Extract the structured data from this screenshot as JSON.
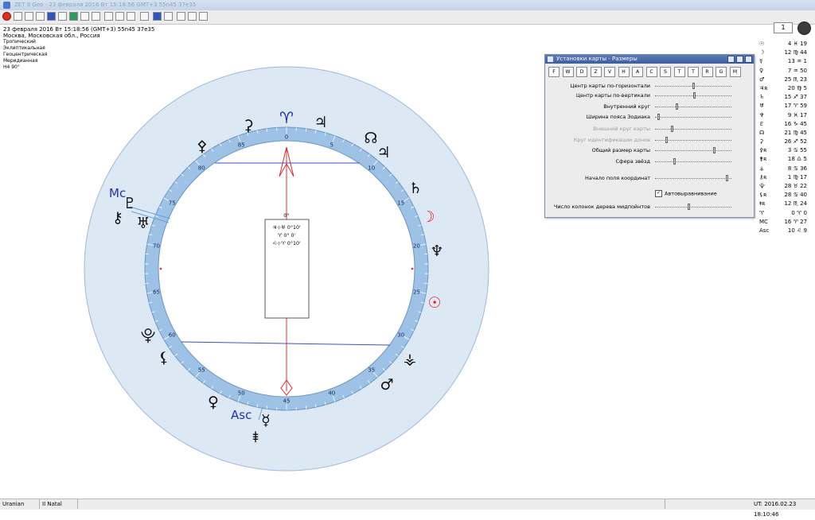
{
  "window": {
    "title": "ZET 9 Geo - 23 февраля 2016  Вт  15:18:56 GMT+3 55n45  37e35"
  },
  "toolbar": {
    "page_value": "1"
  },
  "info": {
    "line1": "23 февраля 2016  Вт  15:18:56 (GMT+3) 55n45  37e35",
    "line2": "Москва, Московская обл., Россия",
    "line3": "Тропический",
    "line4": "Эклиптикальная",
    "line5": "Геоцентрическая",
    "line6": "Меридианная",
    "line7": "H4  90°"
  },
  "chart": {
    "center_box": {
      "header": "0°",
      "row1": "♃⊹♅  0°10'",
      "row2": "♈   0° 0'",
      "row3": "♌⊹♈  0°10'"
    },
    "labels": {
      "mc": "Mc",
      "asc": "Asc"
    },
    "ring_numbers": [
      "0",
      "5",
      "10",
      "15",
      "20",
      "25",
      "30",
      "35",
      "40",
      "45",
      "50",
      "55",
      "60",
      "65",
      "70",
      "75",
      "80",
      "85"
    ],
    "aries_glyph": "♈",
    "colors": {
      "outer_fill": "#dde8f5",
      "ring_fill": "#9ec2e6",
      "inner_fill": "#ffffff",
      "axis_line": "#d83030",
      "cross_line": "#3a4fd0",
      "label_blue": "#2030b0",
      "sun_moon": "#e02020"
    }
  },
  "positions": [
    {
      "glyph": "☉",
      "value": "4 ♓ 19"
    },
    {
      "glyph": "☽",
      "value": "12 ♍ 44"
    },
    {
      "glyph": "☿",
      "value": "13 ♒  1"
    },
    {
      "glyph": "♀",
      "value": "7 ♒ 50"
    },
    {
      "glyph": "♂",
      "value": "25 ♏ 23"
    },
    {
      "glyph": "♃ʀ",
      "value": "20 ♍  5"
    },
    {
      "glyph": "♄",
      "value": "15 ♐ 37"
    },
    {
      "glyph": "♅",
      "value": "17 ♈ 59"
    },
    {
      "glyph": "♆",
      "value": "9 ♓ 17"
    },
    {
      "glyph": "♇",
      "value": "16 ♑ 45"
    },
    {
      "glyph": "☊",
      "value": "21 ♍ 45"
    },
    {
      "glyph": "⚳",
      "value": "26 ♐ 52"
    },
    {
      "glyph": "⚴ʀ",
      "value": "3 ♋ 55"
    },
    {
      "glyph": "⚵ʀ",
      "value": "18 ♎  5"
    },
    {
      "glyph": "⚶",
      "value": "8 ♋ 36"
    },
    {
      "glyph": "⚷ʀ",
      "value": "1 ♍ 17"
    },
    {
      "glyph": "⯓",
      "value": "28 ♉ 22"
    },
    {
      "glyph": "⚸ʀ",
      "value": "28 ♋ 40"
    },
    {
      "glyph": "⯒ʀ",
      "value": "12 ♏ 24"
    },
    {
      "glyph": "♈",
      "value": "0 ♈  0"
    },
    {
      "glyph": "MC",
      "value": "16 ♈ 27"
    },
    {
      "glyph": "Asc",
      "value": "10 ♌  9"
    }
  ],
  "dialog": {
    "title": "Установки карты - Размеры",
    "buttons": [
      "F",
      "W",
      "D",
      "Z",
      "V",
      "H",
      "A",
      "C",
      "S",
      "T",
      "T",
      "R",
      "G",
      "M"
    ],
    "sliders": [
      {
        "label": "Центр карты по-горизонтали",
        "level": 0.5,
        "disabled": false
      },
      {
        "label": "Центр карты по-вертикали",
        "level": 0.52,
        "disabled": false
      },
      {
        "label": "Внутренний круг",
        "level": 0.28,
        "disabled": false
      },
      {
        "label": "Ширина пояса Зодиака",
        "level": 0.03,
        "disabled": false
      },
      {
        "label": "Внешний круг карты",
        "level": 0.22,
        "disabled": true
      },
      {
        "label": "Круг идентификации донов",
        "level": 0.14,
        "disabled": true
      },
      {
        "label": "Общий размер карты",
        "level": 0.78,
        "disabled": false
      },
      {
        "label": "Сфера звёзд",
        "level": 0.25,
        "disabled": false
      },
      {
        "label": "Начало поля координат",
        "level": 0.96,
        "disabled": false
      },
      {
        "label": "Число колонок дерева мидпойнтов",
        "level": 0.44,
        "disabled": false
      }
    ],
    "checkbox_label": "Автовыравнивание",
    "checkbox_checked": true
  },
  "status": {
    "left": "Uranian",
    "mid": "II Natal",
    "ut": "UT: 2016.02.23 18:10:46"
  }
}
